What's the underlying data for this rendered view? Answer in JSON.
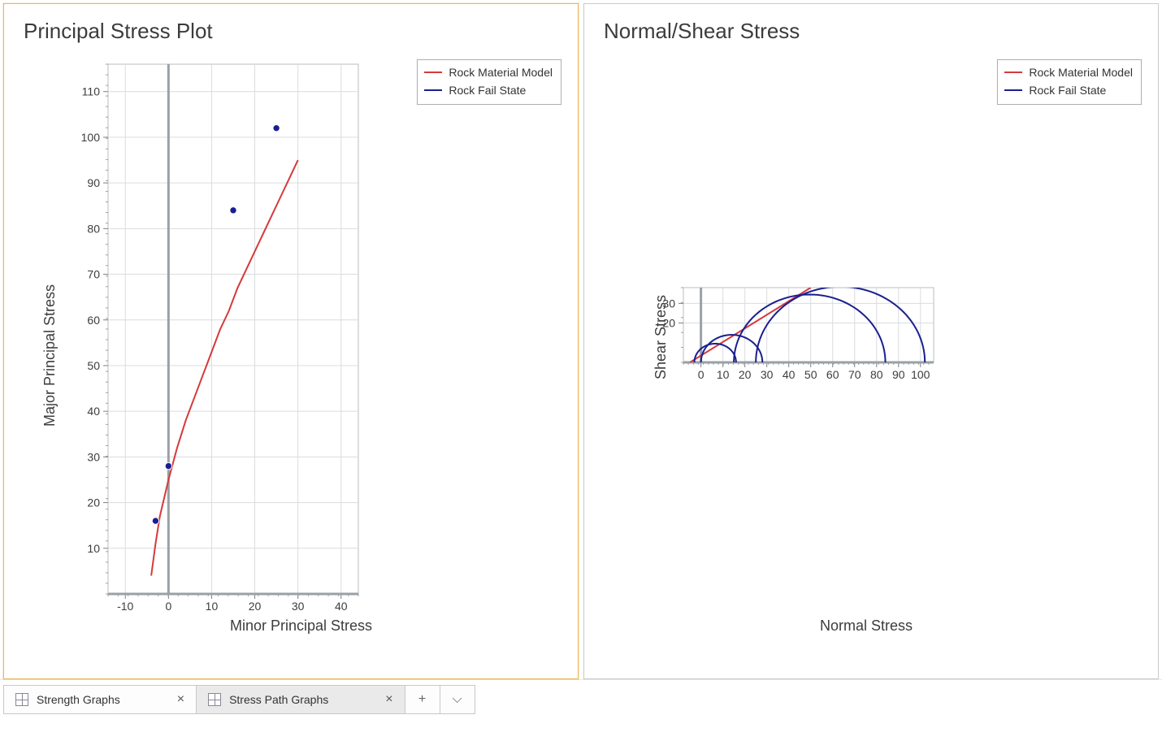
{
  "tabs": [
    {
      "label": "Strength Graphs",
      "active": false
    },
    {
      "label": "Stress Path Graphs",
      "active": true
    }
  ],
  "tab_buttons": {
    "add": "+",
    "menu": "⌵"
  },
  "panel1": {
    "title": "Principal Stress Plot",
    "xlabel": "Minor Principal Stress",
    "ylabel": "Major Principal Stress",
    "legend": {
      "model": "Rock Material Model",
      "fail": "Rock Fail State"
    }
  },
  "panel2": {
    "title": "Normal/Shear Stress",
    "xlabel": "Normal Stress",
    "ylabel": "Shear Stress",
    "legend": {
      "model": "Rock Material Model",
      "fail": "Rock Fail State"
    }
  },
  "chart_data": [
    {
      "id": "principal_stress",
      "type": "line+scatter",
      "title": "Principal Stress Plot",
      "xlabel": "Minor Principal Stress",
      "ylabel": "Major Principal Stress",
      "xlim": [
        -14,
        44
      ],
      "ylim": [
        0,
        116
      ],
      "xticks": [
        -10,
        0,
        10,
        20,
        30,
        40
      ],
      "yticks": [
        10,
        20,
        30,
        40,
        50,
        60,
        70,
        80,
        90,
        100,
        110
      ],
      "series": [
        {
          "name": "Rock Material Model",
          "kind": "line",
          "color": "#d43a3a",
          "x": [
            -4,
            -3,
            -2,
            -1,
            0,
            2,
            4,
            6,
            8,
            10,
            12,
            14,
            16,
            18,
            20,
            22,
            24,
            26,
            28,
            30
          ],
          "y": [
            4,
            11,
            17,
            21,
            25,
            32,
            38,
            43,
            48,
            53,
            58,
            62,
            67,
            71,
            75,
            79,
            83,
            87,
            91,
            95
          ]
        },
        {
          "name": "Rock Fail State",
          "kind": "scatter",
          "color": "#1a1f8f",
          "points": [
            {
              "x": -3,
              "y": 16
            },
            {
              "x": 0,
              "y": 28
            },
            {
              "x": 15,
              "y": 84
            },
            {
              "x": 25,
              "y": 102
            }
          ]
        }
      ]
    },
    {
      "id": "normal_shear",
      "type": "mohr+line",
      "title": "Normal/Shear Stress",
      "xlabel": "Normal Stress",
      "ylabel": "Shear Stress",
      "xlim": [
        -8,
        106
      ],
      "ylim": [
        0,
        38
      ],
      "xticks": [
        0,
        10,
        20,
        30,
        40,
        50,
        60,
        70,
        80,
        90,
        100
      ],
      "yticks": [
        20,
        30
      ],
      "series": [
        {
          "name": "Rock Material Model",
          "kind": "line",
          "color": "#d43a3a",
          "x": [
            -5,
            50
          ],
          "y": [
            0,
            38
          ]
        },
        {
          "name": "Rock Fail State",
          "kind": "mohr_circles",
          "color": "#1a1f8f",
          "circles": [
            {
              "sigma3": -3,
              "sigma1": 16
            },
            {
              "sigma3": 0,
              "sigma1": 28
            },
            {
              "sigma3": 15,
              "sigma1": 84
            },
            {
              "sigma3": 25,
              "sigma1": 102
            }
          ]
        }
      ]
    }
  ]
}
